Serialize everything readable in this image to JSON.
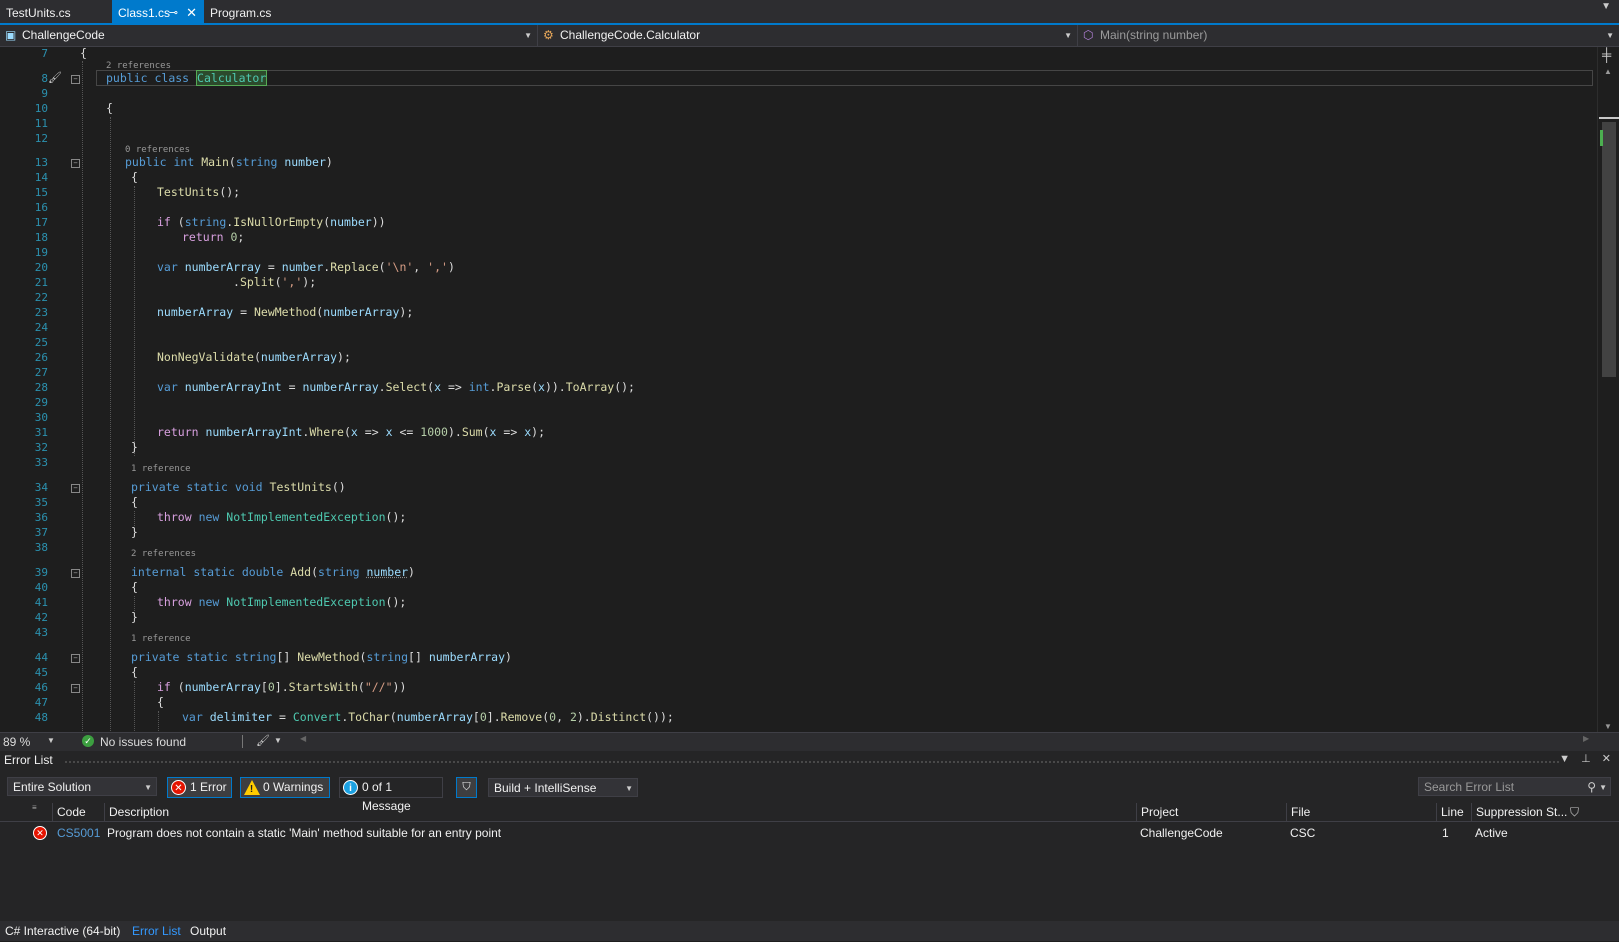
{
  "tabs": [
    {
      "label": "TestUnits.cs"
    },
    {
      "label": "Class1.cs",
      "active": true
    },
    {
      "label": "Program.cs"
    }
  ],
  "navbar": {
    "project": "ChallengeCode",
    "class": "ChallengeCode.Calculator",
    "member": "Main(string number)"
  },
  "editor": {
    "line_numbers": [
      "7",
      "8",
      "9",
      "10",
      "11",
      "12",
      "13",
      "14",
      "15",
      "16",
      "17",
      "18",
      "19",
      "20",
      "21",
      "22",
      "23",
      "24",
      "25",
      "26",
      "27",
      "28",
      "29",
      "30",
      "31",
      "32",
      "33",
      "34",
      "35",
      "36",
      "37",
      "38",
      "39",
      "40",
      "41",
      "42",
      "43",
      "44",
      "45",
      "46",
      "47",
      "48"
    ],
    "lenses": {
      "class": "2 references",
      "main": "0 references",
      "testunits": "1 reference",
      "add": "2 references",
      "newmethod": "1 reference"
    }
  },
  "status": {
    "zoom": "89 %",
    "issues": "No issues found"
  },
  "errorlist": {
    "title": "Error List",
    "scope": "Entire Solution",
    "errors_btn": "1 Error",
    "warnings_btn": "0 Warnings",
    "messages_btn": "0 of 1 Message",
    "build_filter": "Build + IntelliSense",
    "search_placeholder": "Search Error List",
    "columns": {
      "code": "Code",
      "description": "Description",
      "project": "Project",
      "file": "File",
      "line": "Line",
      "suppression": "Suppression St..."
    },
    "rows": [
      {
        "code": "CS5001",
        "description": "Program does not contain a static 'Main' method suitable for an entry point",
        "project": "ChallengeCode",
        "file": "CSC",
        "line": "1",
        "suppression": "Active"
      }
    ]
  },
  "bottom_tabs": [
    "C# Interactive (64-bit)",
    "Error List",
    "Output"
  ],
  "colors": {
    "accent": "#007acc",
    "keyword": "#569cd6",
    "type": "#4ec9b0",
    "method": "#dcdcaa",
    "error": "#e51400"
  }
}
